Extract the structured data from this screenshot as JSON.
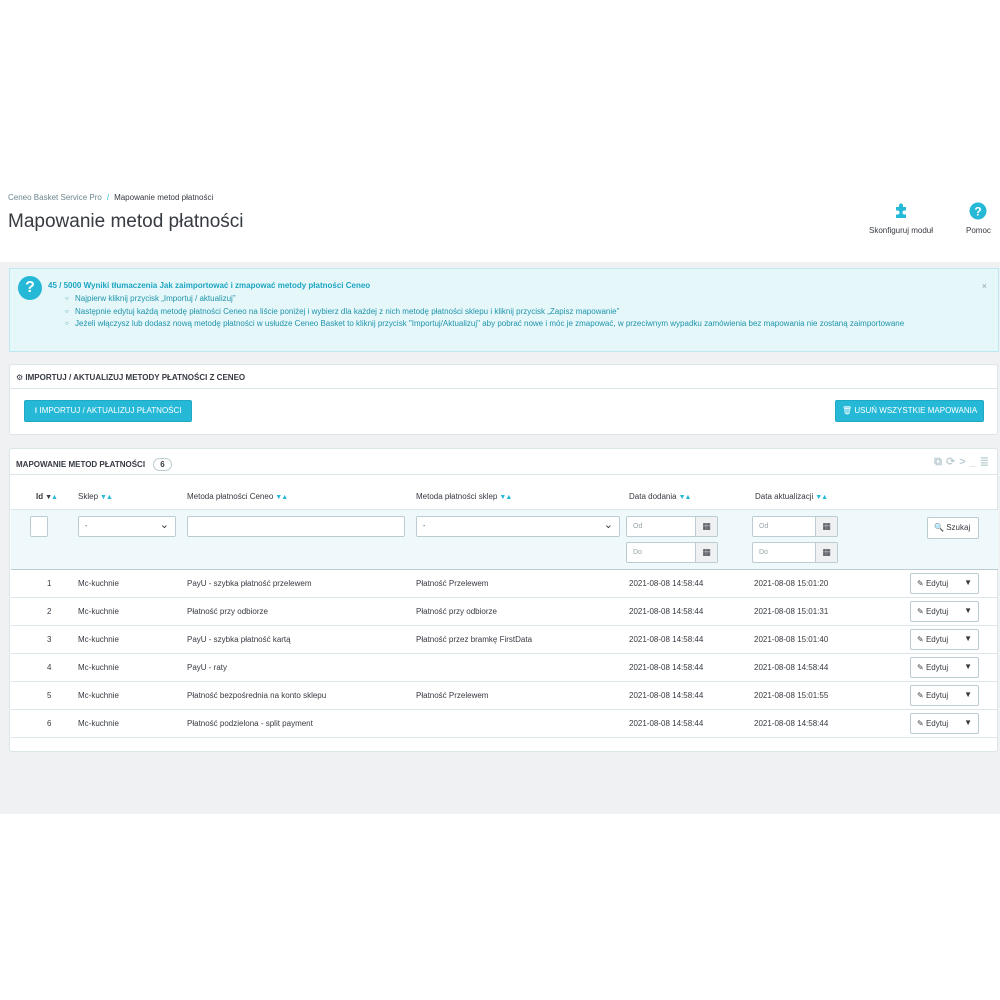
{
  "breadcrumb": {
    "parent": "Ceneo Basket Service Pro",
    "separator": "/",
    "current": "Mapowanie metod płatności"
  },
  "page_title": "Mapowanie metod płatności",
  "toolbar": {
    "configure_label": "Skonfiguruj moduł",
    "help_label": "Pomoc"
  },
  "alert": {
    "title": "45 / 5000 Wyniki tłumaczenia Jak zaimportować i zmapować metody płatności Ceneo",
    "close": "×",
    "items": [
      "Najpierw kliknij przycisk „Importuj / aktualizuj”",
      "Następnie edytuj każdą metodę płatności Ceneo na liście poniżej i wybierz dla każdej z nich metodę płatności sklepu i kliknij przycisk „Zapisz mapowanie”",
      "Jeżeli włączysz lub dodasz nową metodę płatności w usłudze Ceneo Basket to kliknij przycisk \"Importuj/Aktualizuj\" aby pobrać nowe i móc je zmapować, w przeciwnym wypadku zamówienia bez mapowania nie zostaną zaimportowane"
    ]
  },
  "import_panel": {
    "title": "IMPORTUJ / AKTUALIZUJ METODY PŁATNOŚCI Z CENEO",
    "import_button": "IMPORTUJ / AKTUALIZUJ PŁATNOŚCI",
    "delete_button": "USUŃ WSZYSTKIE MAPOWANIA"
  },
  "mapping_panel": {
    "title": "MAPOWANIE METOD PŁATNOŚCI",
    "count": "6",
    "columns": [
      "Id",
      "Sklep",
      "Metoda płatności Ceneo",
      "Metoda płatności sklep",
      "Data dodania",
      "Data aktualizacji"
    ],
    "filters": {
      "shop_value": "-",
      "shop_method_value": "-",
      "date_from_placeholder": "Od",
      "date_to_placeholder": "Do",
      "search_button": "Szukaj"
    },
    "edit_label": "Edytuj",
    "rows": [
      {
        "id": "1",
        "shop": "Mc-kuchnie",
        "ceneo_method": "PayU - szybka płatność przelewem",
        "shop_method": "Płatność Przelewem",
        "added": "2021-08-08 14:58:44",
        "updated": "2021-08-08 15:01:20"
      },
      {
        "id": "2",
        "shop": "Mc-kuchnie",
        "ceneo_method": "Płatność przy odbiorze",
        "shop_method": "Płatność przy odbiorze",
        "added": "2021-08-08 14:58:44",
        "updated": "2021-08-08 15:01:31"
      },
      {
        "id": "3",
        "shop": "Mc-kuchnie",
        "ceneo_method": "PayU - szybka płatność kartą",
        "shop_method": "Płatność przez bramkę FirstData",
        "added": "2021-08-08 14:58:44",
        "updated": "2021-08-08 15:01:40"
      },
      {
        "id": "4",
        "shop": "Mc-kuchnie",
        "ceneo_method": "PayU - raty",
        "shop_method": "",
        "added": "2021-08-08 14:58:44",
        "updated": "2021-08-08 14:58:44"
      },
      {
        "id": "5",
        "shop": "Mc-kuchnie",
        "ceneo_method": "Płatność bezpośrednia na konto sklepu",
        "shop_method": "Płatność Przelewem",
        "added": "2021-08-08 14:58:44",
        "updated": "2021-08-08 15:01:55"
      },
      {
        "id": "6",
        "shop": "Mc-kuchnie",
        "ceneo_method": "Płatność podzielona - split payment",
        "shop_method": "",
        "added": "2021-08-08 14:58:44",
        "updated": "2021-08-08 14:58:44"
      }
    ]
  },
  "colors": {
    "accent": "#25b9d7",
    "alert_bg": "#e6f7fa",
    "page_bg": "#eff1f2",
    "text": "#363a41"
  },
  "icons": {
    "configure": "puzzle-icon",
    "help": "question-circle-icon",
    "calendar": "calendar-icon",
    "search": "search-icon",
    "edit": "pencil-icon"
  }
}
